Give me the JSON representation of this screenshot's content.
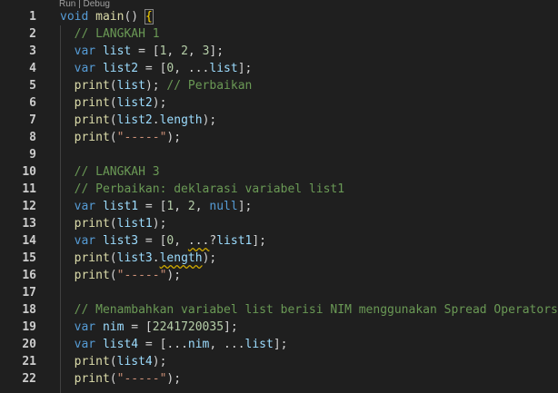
{
  "codelens": "Run | Debug",
  "lines": [
    {
      "number": "1",
      "tokens": [
        {
          "text": "void",
          "type": "keyword"
        },
        {
          "text": " ",
          "type": "plain"
        },
        {
          "text": "main",
          "type": "function"
        },
        {
          "text": "() ",
          "type": "plain"
        },
        {
          "text": "{",
          "type": "bracket-match"
        }
      ]
    },
    {
      "number": "2",
      "tokens": [
        {
          "text": "  // LANGKAH 1",
          "type": "comment"
        }
      ]
    },
    {
      "number": "3",
      "tokens": [
        {
          "text": "  ",
          "type": "plain"
        },
        {
          "text": "var",
          "type": "keyword"
        },
        {
          "text": " ",
          "type": "plain"
        },
        {
          "text": "list",
          "type": "variable"
        },
        {
          "text": " = [",
          "type": "plain"
        },
        {
          "text": "1",
          "type": "number"
        },
        {
          "text": ", ",
          "type": "plain"
        },
        {
          "text": "2",
          "type": "number"
        },
        {
          "text": ", ",
          "type": "plain"
        },
        {
          "text": "3",
          "type": "number"
        },
        {
          "text": "];",
          "type": "plain"
        }
      ]
    },
    {
      "number": "4",
      "tokens": [
        {
          "text": "  ",
          "type": "plain"
        },
        {
          "text": "var",
          "type": "keyword"
        },
        {
          "text": " ",
          "type": "plain"
        },
        {
          "text": "list2",
          "type": "variable"
        },
        {
          "text": " = [",
          "type": "plain"
        },
        {
          "text": "0",
          "type": "number"
        },
        {
          "text": ", ...",
          "type": "plain"
        },
        {
          "text": "list",
          "type": "variable"
        },
        {
          "text": "];",
          "type": "plain"
        }
      ]
    },
    {
      "number": "5",
      "tokens": [
        {
          "text": "  ",
          "type": "plain"
        },
        {
          "text": "print",
          "type": "function"
        },
        {
          "text": "(",
          "type": "plain"
        },
        {
          "text": "list",
          "type": "variable"
        },
        {
          "text": "); ",
          "type": "plain"
        },
        {
          "text": "// Perbaikan",
          "type": "comment"
        }
      ]
    },
    {
      "number": "6",
      "tokens": [
        {
          "text": "  ",
          "type": "plain"
        },
        {
          "text": "print",
          "type": "function"
        },
        {
          "text": "(",
          "type": "plain"
        },
        {
          "text": "list2",
          "type": "variable"
        },
        {
          "text": ");",
          "type": "plain"
        }
      ]
    },
    {
      "number": "7",
      "tokens": [
        {
          "text": "  ",
          "type": "plain"
        },
        {
          "text": "print",
          "type": "function"
        },
        {
          "text": "(",
          "type": "plain"
        },
        {
          "text": "list2",
          "type": "variable"
        },
        {
          "text": ".",
          "type": "plain"
        },
        {
          "text": "length",
          "type": "variable"
        },
        {
          "text": ");",
          "type": "plain"
        }
      ]
    },
    {
      "number": "8",
      "tokens": [
        {
          "text": "  ",
          "type": "plain"
        },
        {
          "text": "print",
          "type": "function"
        },
        {
          "text": "(",
          "type": "plain"
        },
        {
          "text": "\"-----\"",
          "type": "string"
        },
        {
          "text": ");",
          "type": "plain"
        }
      ]
    },
    {
      "number": "9",
      "tokens": []
    },
    {
      "number": "10",
      "tokens": [
        {
          "text": "  // LANGKAH 3",
          "type": "comment"
        }
      ]
    },
    {
      "number": "11",
      "tokens": [
        {
          "text": "  // Perbaikan: deklarasi variabel list1",
          "type": "comment"
        }
      ]
    },
    {
      "number": "12",
      "tokens": [
        {
          "text": "  ",
          "type": "plain"
        },
        {
          "text": "var",
          "type": "keyword"
        },
        {
          "text": " ",
          "type": "plain"
        },
        {
          "text": "list1",
          "type": "variable"
        },
        {
          "text": " = [",
          "type": "plain"
        },
        {
          "text": "1",
          "type": "number"
        },
        {
          "text": ", ",
          "type": "plain"
        },
        {
          "text": "2",
          "type": "number"
        },
        {
          "text": ", ",
          "type": "plain"
        },
        {
          "text": "null",
          "type": "keyword"
        },
        {
          "text": "];",
          "type": "plain"
        }
      ]
    },
    {
      "number": "13",
      "tokens": [
        {
          "text": "  ",
          "type": "plain"
        },
        {
          "text": "print",
          "type": "function"
        },
        {
          "text": "(",
          "type": "plain"
        },
        {
          "text": "list1",
          "type": "variable"
        },
        {
          "text": ");",
          "type": "plain"
        }
      ]
    },
    {
      "number": "14",
      "tokens": [
        {
          "text": "  ",
          "type": "plain"
        },
        {
          "text": "var",
          "type": "keyword"
        },
        {
          "text": " ",
          "type": "plain"
        },
        {
          "text": "list3",
          "type": "variable"
        },
        {
          "text": " = [",
          "type": "plain"
        },
        {
          "text": "0",
          "type": "number"
        },
        {
          "text": ", ",
          "type": "plain"
        },
        {
          "text": "...",
          "type": "squiggle"
        },
        {
          "text": "?",
          "type": "plain"
        },
        {
          "text": "list1",
          "type": "variable"
        },
        {
          "text": "];",
          "type": "plain"
        }
      ]
    },
    {
      "number": "15",
      "tokens": [
        {
          "text": "  ",
          "type": "plain"
        },
        {
          "text": "print",
          "type": "function"
        },
        {
          "text": "(",
          "type": "plain"
        },
        {
          "text": "list3",
          "type": "variable"
        },
        {
          "text": ".",
          "type": "plain"
        },
        {
          "text": "length",
          "type": "squiggle-variable"
        },
        {
          "text": ");",
          "type": "plain"
        }
      ]
    },
    {
      "number": "16",
      "tokens": [
        {
          "text": "  ",
          "type": "plain"
        },
        {
          "text": "print",
          "type": "function"
        },
        {
          "text": "(",
          "type": "plain"
        },
        {
          "text": "\"-----\"",
          "type": "string"
        },
        {
          "text": ");",
          "type": "plain"
        }
      ]
    },
    {
      "number": "17",
      "tokens": []
    },
    {
      "number": "18",
      "tokens": [
        {
          "text": "  // Menambahkan variabel list berisi NIM menggunakan Spread Operators",
          "type": "comment"
        }
      ]
    },
    {
      "number": "19",
      "tokens": [
        {
          "text": "  ",
          "type": "plain"
        },
        {
          "text": "var",
          "type": "keyword"
        },
        {
          "text": " ",
          "type": "plain"
        },
        {
          "text": "nim",
          "type": "variable"
        },
        {
          "text": " = [",
          "type": "plain"
        },
        {
          "text": "2241720035",
          "type": "number"
        },
        {
          "text": "];",
          "type": "plain"
        }
      ]
    },
    {
      "number": "20",
      "tokens": [
        {
          "text": "  ",
          "type": "plain"
        },
        {
          "text": "var",
          "type": "keyword"
        },
        {
          "text": " ",
          "type": "plain"
        },
        {
          "text": "list4",
          "type": "variable"
        },
        {
          "text": " = [...",
          "type": "plain"
        },
        {
          "text": "nim",
          "type": "variable"
        },
        {
          "text": ", ...",
          "type": "plain"
        },
        {
          "text": "list",
          "type": "variable"
        },
        {
          "text": "];",
          "type": "plain"
        }
      ]
    },
    {
      "number": "21",
      "tokens": [
        {
          "text": "  ",
          "type": "plain"
        },
        {
          "text": "print",
          "type": "function"
        },
        {
          "text": "(",
          "type": "plain"
        },
        {
          "text": "list4",
          "type": "variable"
        },
        {
          "text": ");",
          "type": "plain"
        }
      ]
    },
    {
      "number": "22",
      "tokens": [
        {
          "text": "  ",
          "type": "plain"
        },
        {
          "text": "print",
          "type": "function"
        },
        {
          "text": "(",
          "type": "plain"
        },
        {
          "text": "\"-----\"",
          "type": "string"
        },
        {
          "text": ");",
          "type": "plain"
        }
      ]
    }
  ]
}
